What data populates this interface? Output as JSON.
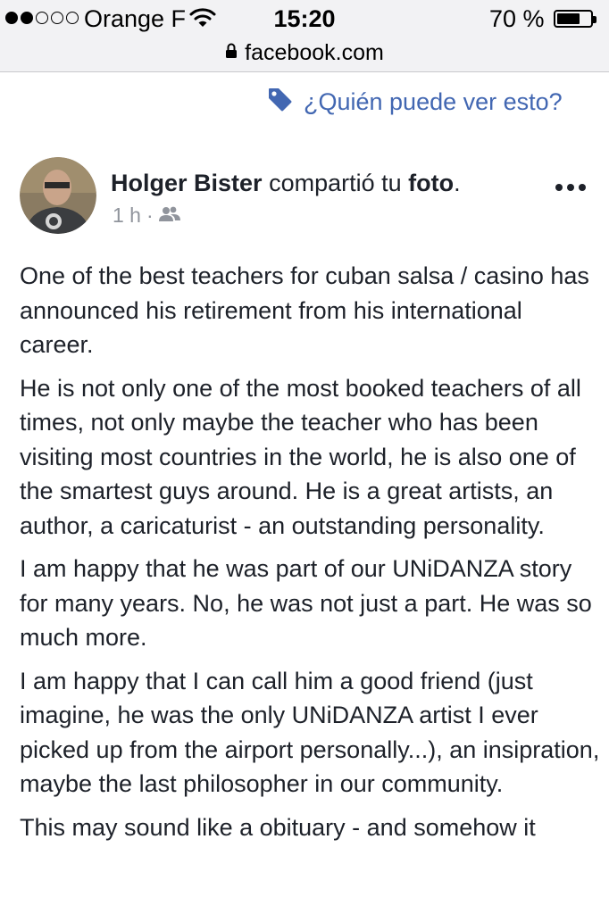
{
  "status_bar": {
    "carrier": "Orange F",
    "time": "15:20",
    "battery": "70 %",
    "battery_level": 0.7,
    "signal_bars_filled": 2,
    "signal_bars_total": 5
  },
  "browser": {
    "url": "facebook.com"
  },
  "audience_link": {
    "label": "¿Quién puede ver esto?",
    "color": "#4267b2"
  },
  "post": {
    "author": "Holger Bister",
    "action": "compartió tu",
    "object": "foto",
    "object_suffix": ".",
    "time": "1 h",
    "separator": "·",
    "privacy_icon": "friends-icon",
    "paragraphs": [
      "One of the best teachers for cuban salsa / casino has announced his retirement from his international career.",
      "He is not only one of the most booked teachers of all times, not only maybe the teacher who has been visiting most countries in the world, he is also one of the smartest guys around. He is a great artists, an author, a caricaturist - an outstanding personality.",
      "I am happy that he was part of our UNiDANZA story for many years. No, he was not just a part. He was so much more.",
      "I am happy that I can call him a good friend (just imagine, he was the only UNiDANZA artist I ever picked up from the airport personally...), an insipration, maybe the last philosopher in our community.",
      "This may sound like a obituary - and somehow it"
    ]
  }
}
